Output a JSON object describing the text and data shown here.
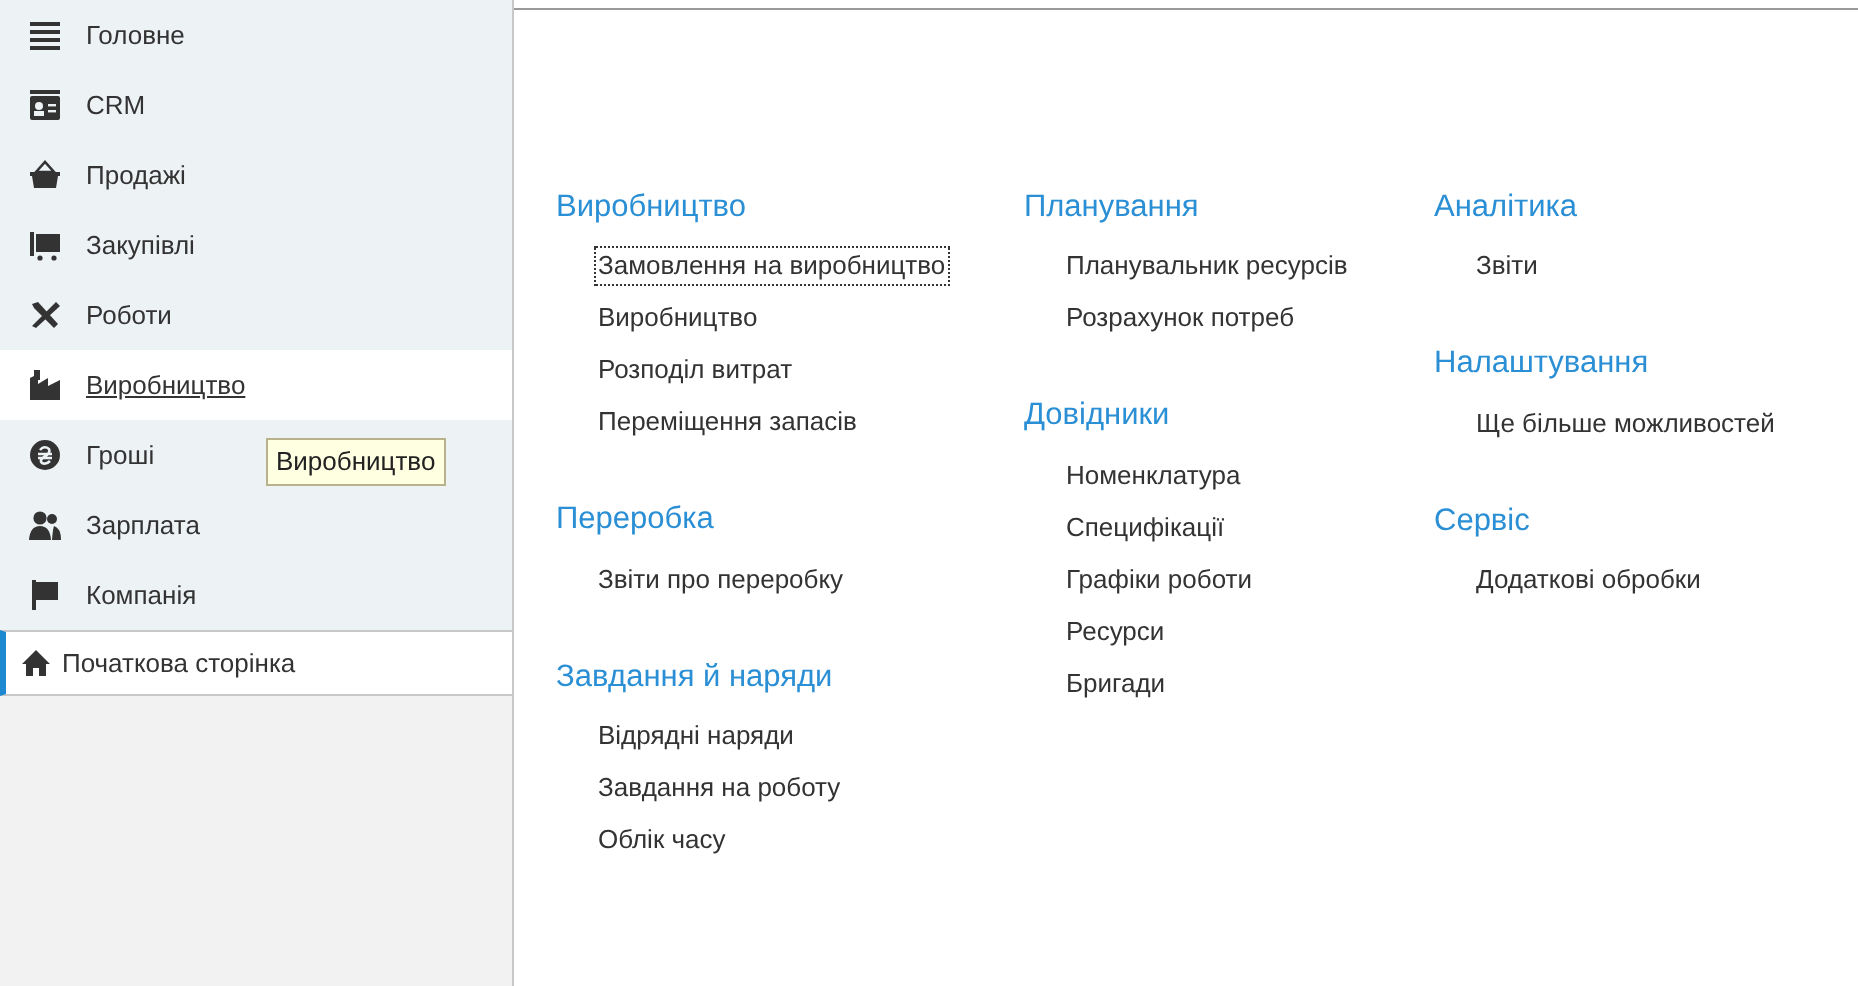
{
  "sidebar": {
    "items": [
      {
        "label": "Головне",
        "selected": false
      },
      {
        "label": "CRM",
        "selected": false
      },
      {
        "label": "Продажі",
        "selected": false
      },
      {
        "label": "Закупівлі",
        "selected": false
      },
      {
        "label": "Роботи",
        "selected": false
      },
      {
        "label": "Виробництво",
        "selected": true
      },
      {
        "label": "Гроші",
        "selected": false
      },
      {
        "label": "Зарплата",
        "selected": false
      },
      {
        "label": "Компанія",
        "selected": false
      }
    ],
    "tooltip": "Виробництво",
    "tabs": [
      {
        "label": "Початкова сторінка",
        "selected": true
      }
    ]
  },
  "columns": [
    [
      {
        "title": "Виробництво",
        "items": [
          {
            "label": "Замовлення на виробництво",
            "focused": true
          },
          {
            "label": "Виробництво",
            "focused": false
          },
          {
            "label": "Розподіл витрат",
            "focused": false
          },
          {
            "label": "Переміщення запасів",
            "focused": false
          }
        ]
      },
      {
        "title": "Переробка",
        "items": [
          {
            "label": "Звіти про переробку",
            "focused": false
          }
        ]
      },
      {
        "title": "Завдання й наряди",
        "items": [
          {
            "label": "Відрядні наряди",
            "focused": false
          },
          {
            "label": "Завдання на роботу",
            "focused": false
          },
          {
            "label": "Облік часу",
            "focused": false
          }
        ]
      }
    ],
    [
      {
        "title": "Планування",
        "items": [
          {
            "label": "Планувальник ресурсів",
            "focused": false
          },
          {
            "label": "Розрахунок потреб",
            "focused": false
          }
        ]
      },
      {
        "title": "Довідники",
        "items": [
          {
            "label": "Номенклатура",
            "focused": false
          },
          {
            "label": "Специфікації",
            "focused": false
          },
          {
            "label": "Графіки роботи",
            "focused": false
          },
          {
            "label": "Ресурси",
            "focused": false
          },
          {
            "label": "Бригади",
            "focused": false
          }
        ]
      }
    ],
    [
      {
        "title": "Аналітика",
        "items": [
          {
            "label": "Звіти",
            "focused": false
          }
        ]
      },
      {
        "title": "Налаштування",
        "items": [
          {
            "label": "Ще більше можливостей",
            "focused": false
          }
        ]
      },
      {
        "title": "Сервіс",
        "items": [
          {
            "label": "Додаткові обробки",
            "focused": false
          }
        ]
      }
    ]
  ]
}
